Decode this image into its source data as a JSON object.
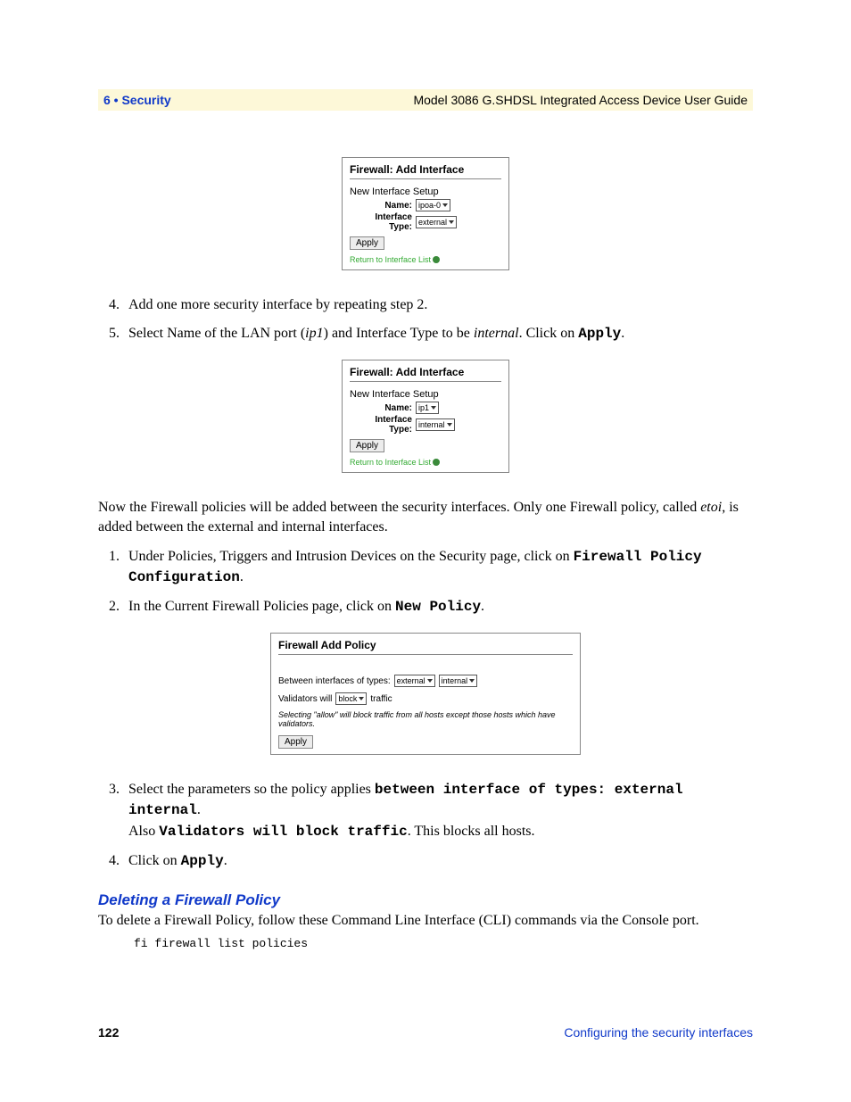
{
  "header": {
    "chapter": "6 • Security",
    "doc_title": "Model 3086 G.SHDSL Integrated Access Device User Guide"
  },
  "fig1": {
    "title": "Firewall: Add Interface",
    "subtitle": "New Interface Setup",
    "name_label": "Name:",
    "name_value": "ipoa-0",
    "type_label": "Interface Type:",
    "type_value": "external",
    "apply": "Apply",
    "return_link": "Return to Interface List"
  },
  "step4": "Add one more security interface by repeating step 2.",
  "step5_pre": "Select Name of the LAN port (",
  "step5_ip": "ip1",
  "step5_mid": ") and Interface Type to be ",
  "step5_internal": "internal",
  "step5_post": ". Click on ",
  "step5_apply": "Apply",
  "step5_end": ".",
  "fig2": {
    "title": "Firewall: Add Interface",
    "subtitle": "New Interface Setup",
    "name_label": "Name:",
    "name_value": "ip1",
    "type_label": "Interface Type:",
    "type_value": "internal",
    "apply": "Apply",
    "return_link": "Return to Interface List"
  },
  "para1a": "Now the Firewall policies will be added between the security interfaces.  Only one Firewall policy, called ",
  "para1_etoi": "etoi",
  "para1b": ", is added between the external and internal interfaces.",
  "pol_step1a": "Under Policies, Triggers and Intrusion Devices on the Security page, click on ",
  "pol_step1b": "Firewall Policy Configuration",
  "pol_step1c": ".",
  "pol_step2a": "In the Current Firewall Policies page, click on ",
  "pol_step2b": "New Policy",
  "pol_step2c": ".",
  "fig3": {
    "title": "Firewall Add Policy",
    "between": "Between interfaces of types:",
    "sel1": "external",
    "sel2": "internal",
    "validators_pre": "Validators will",
    "validators_sel": "block",
    "validators_post": "traffic",
    "note": "Selecting \"allow\" will block traffic from all hosts except those hosts which have validators.",
    "apply": "Apply"
  },
  "pol_step3a": "Select the parameters so the policy applies ",
  "pol_step3b": "between interface of types: external internal",
  "pol_step3c": ".",
  "pol_step3d": "Also ",
  "pol_step3e": "Validators will block traffic",
  "pol_step3f": ". This blocks all hosts.",
  "pol_step4a": "Click on ",
  "pol_step4b": "Apply",
  "pol_step4c": ".",
  "section_heading": "Deleting a Firewall Policy",
  "delete_intro": "To delete a Firewall Policy, follow these Command Line Interface (CLI) commands via the Console port.",
  "cli": "fi firewall list policies",
  "footer": {
    "page": "122",
    "section": "Configuring the security interfaces"
  }
}
